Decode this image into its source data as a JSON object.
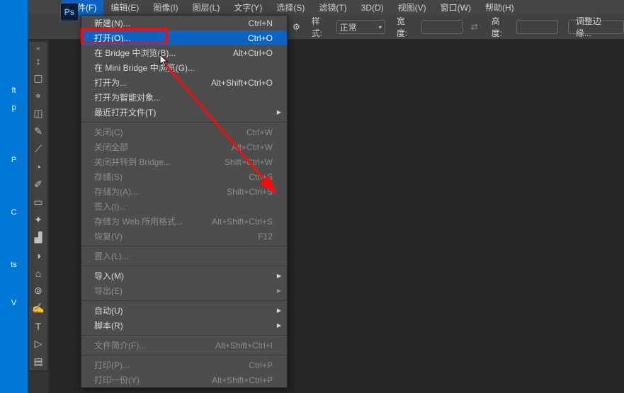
{
  "app_badge": "Ps",
  "menubar": [
    "文件(F)",
    "编辑(E)",
    "图像(I)",
    "图层(L)",
    "文字(Y)",
    "选择(S)",
    "滤镜(T)",
    "3D(D)",
    "视图(V)",
    "窗口(W)",
    "帮助(H)"
  ],
  "toolbar": {
    "gear_icon": "⚙",
    "style_label": "样式:",
    "style_value": "正常",
    "width_label": "宽度:",
    "link_icon": "⇄",
    "height_label": "高度:",
    "refine_label": "调整边缘..."
  },
  "desktop": {
    "labels": [
      "ft",
      "p",
      "P",
      "C",
      "ts",
      "V"
    ]
  },
  "tools": [
    "↕",
    "▢",
    "⌖",
    "◫",
    "✎",
    "⟋",
    "◔",
    "✐",
    "▭",
    "✦",
    "▟",
    "◑",
    "⌂",
    "⊚",
    "✍",
    "T",
    "▷",
    "▤"
  ],
  "menu": {
    "groups": [
      [
        {
          "label": "新建(N)...",
          "shortcut": "Ctrl+N",
          "sel": false,
          "dis": false
        },
        {
          "label": "打开(O)...",
          "shortcut": "Ctrl+O",
          "sel": true,
          "dis": false
        },
        {
          "label": "在 Bridge 中浏览(B)...",
          "shortcut": "Alt+Ctrl+O",
          "sel": false,
          "dis": false
        },
        {
          "label": "在 Mini Bridge 中浏览(G)...",
          "shortcut": "",
          "sel": false,
          "dis": false
        },
        {
          "label": "打开为...",
          "shortcut": "Alt+Shift+Ctrl+O",
          "sel": false,
          "dis": false
        },
        {
          "label": "打开为智能对象...",
          "shortcut": "",
          "sel": false,
          "dis": false
        },
        {
          "label": "最近打开文件(T)",
          "shortcut": "",
          "sel": false,
          "dis": false,
          "sub": true
        }
      ],
      [
        {
          "label": "关闭(C)",
          "shortcut": "Ctrl+W",
          "sel": false,
          "dis": true
        },
        {
          "label": "关闭全部",
          "shortcut": "Alt+Ctrl+W",
          "sel": false,
          "dis": true
        },
        {
          "label": "关闭并转到 Bridge...",
          "shortcut": "Shift+Ctrl+W",
          "sel": false,
          "dis": true
        },
        {
          "label": "存储(S)",
          "shortcut": "Ctrl+S",
          "sel": false,
          "dis": true
        },
        {
          "label": "存储为(A)...",
          "shortcut": "Shift+Ctrl+S",
          "sel": false,
          "dis": true
        },
        {
          "label": "签入(I)...",
          "shortcut": "",
          "sel": false,
          "dis": true
        },
        {
          "label": "存储为 Web 所用格式...",
          "shortcut": "Alt+Shift+Ctrl+S",
          "sel": false,
          "dis": true
        },
        {
          "label": "恢复(V)",
          "shortcut": "F12",
          "sel": false,
          "dis": true
        }
      ],
      [
        {
          "label": "置入(L)...",
          "shortcut": "",
          "sel": false,
          "dis": true
        }
      ],
      [
        {
          "label": "导入(M)",
          "shortcut": "",
          "sel": false,
          "dis": false,
          "sub": true
        },
        {
          "label": "导出(E)",
          "shortcut": "",
          "sel": false,
          "dis": true,
          "sub": true
        }
      ],
      [
        {
          "label": "自动(U)",
          "shortcut": "",
          "sel": false,
          "dis": false,
          "sub": true
        },
        {
          "label": "脚本(R)",
          "shortcut": "",
          "sel": false,
          "dis": false,
          "sub": true
        }
      ],
      [
        {
          "label": "文件简介(F)...",
          "shortcut": "Alt+Shift+Ctrl+I",
          "sel": false,
          "dis": true
        }
      ],
      [
        {
          "label": "打印(P)...",
          "shortcut": "Ctrl+P",
          "sel": false,
          "dis": true
        },
        {
          "label": "打印一份(Y)",
          "shortcut": "Alt+Shift+Ctrl+P",
          "sel": false,
          "dis": true
        }
      ]
    ]
  }
}
